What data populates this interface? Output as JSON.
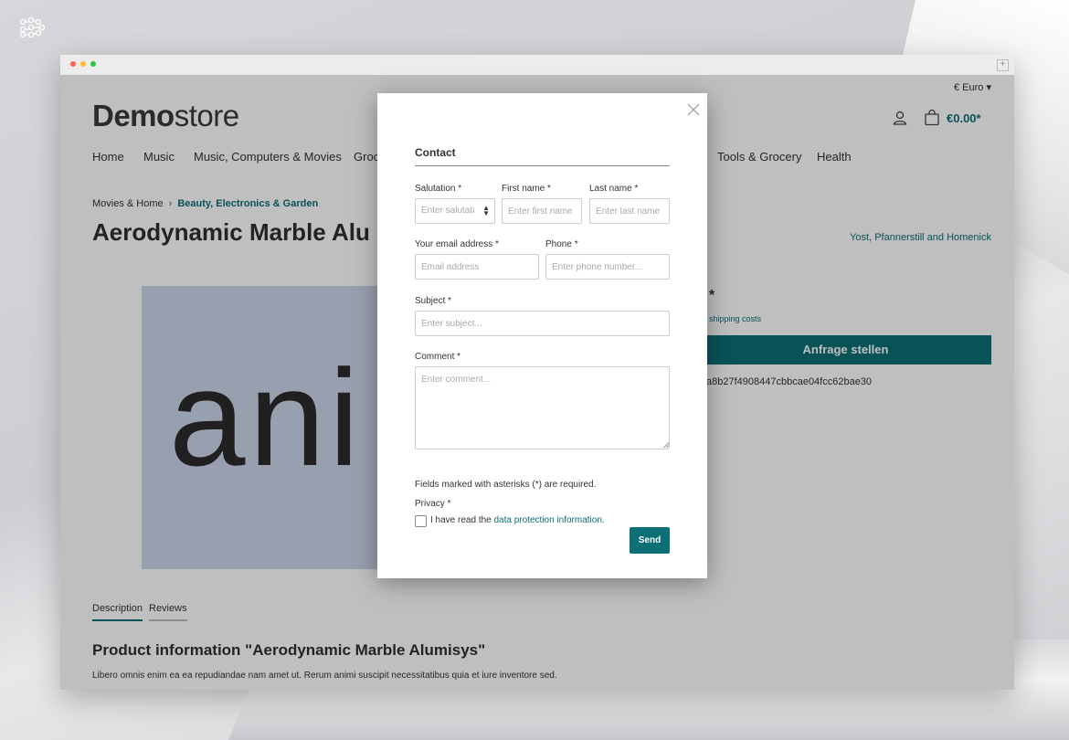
{
  "colors": {
    "accent": "#0b6f76",
    "text": "#333333",
    "image_bg": "#cbd5e8"
  },
  "header": {
    "currency": "€ Euro",
    "logo_bold": "Demo",
    "logo_light": "store",
    "cart_total": "€0.00*"
  },
  "nav": {
    "items": [
      "Home",
      "Music",
      "Music, Computers & Movies",
      "Groc",
      "Tools & Grocery",
      "Health"
    ]
  },
  "breadcrumb": {
    "items": [
      "Movies & Home",
      "Beauty, Electronics & Garden"
    ]
  },
  "product": {
    "title": "Aerodynamic Marble Alu",
    "manufacturer": "Yost, Pfannerstill and Homenick",
    "price_star": "*",
    "shipping": "shipping costs",
    "request_button": "Anfrage stellen",
    "hash": "a8b27f4908447cbbcae04fcc62bae30",
    "image_text": "ani"
  },
  "tabs": [
    "Description",
    "Reviews"
  ],
  "info": {
    "title": "Product information \"Aerodynamic Marble Alumisys\"",
    "text": "Libero omnis enim ea ea repudiandae nam amet ut. Rerum animi suscipit necessitatibus quia et iure inventore sed."
  },
  "modal": {
    "title": "Contact",
    "salutation_label": "Salutation *",
    "salutation_placeholder": "Enter salutati",
    "first_name_label": "First name *",
    "first_name_placeholder": "Enter first name",
    "last_name_label": "Last name *",
    "last_name_placeholder": "Enter last name",
    "email_label": "Your email address *",
    "email_placeholder": "Email address",
    "phone_label": "Phone *",
    "phone_placeholder": "Enter phone number...",
    "subject_label": "Subject *",
    "subject_placeholder": "Enter subject...",
    "comment_label": "Comment *",
    "comment_placeholder": "Enter comment...",
    "required_note": "Fields marked with asterisks (*) are required.",
    "privacy_label": "Privacy *",
    "privacy_text": "I have read the",
    "privacy_link": "data protection information.",
    "send_button": "Send"
  }
}
